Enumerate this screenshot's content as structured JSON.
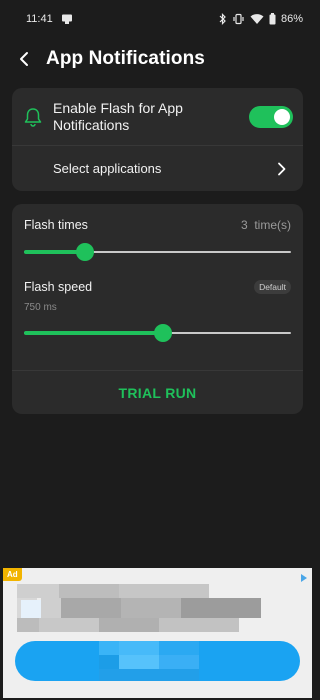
{
  "status_bar": {
    "time": "11:41",
    "battery": "86%"
  },
  "header": {
    "title": "App Notifications"
  },
  "enable_card": {
    "enable_label": "Enable Flash for App Notifications",
    "toggle_on": true,
    "select_label": "Select applications"
  },
  "flash_card": {
    "flash_times": {
      "title": "Flash times",
      "value": "3",
      "unit": "time(s)",
      "level": 0.23
    },
    "flash_speed": {
      "title": "Flash speed",
      "badge": "Default",
      "value": "750 ms",
      "level": 0.52
    },
    "trial_label": "TRIAL RUN"
  },
  "ad": {
    "badge": "Ad"
  },
  "colors": {
    "accent": "#1fc15b",
    "background": "#1c1c1c",
    "card": "#2b2b2b",
    "ad_button": "#1aa3f2"
  },
  "icons": {
    "back": "back-arrow-icon",
    "bell": "bell-icon",
    "chevron": "chevron-right-icon",
    "bluetooth": "bluetooth-icon",
    "vibrate": "vibrate-icon",
    "wifi": "wifi-icon",
    "battery": "battery-icon"
  }
}
